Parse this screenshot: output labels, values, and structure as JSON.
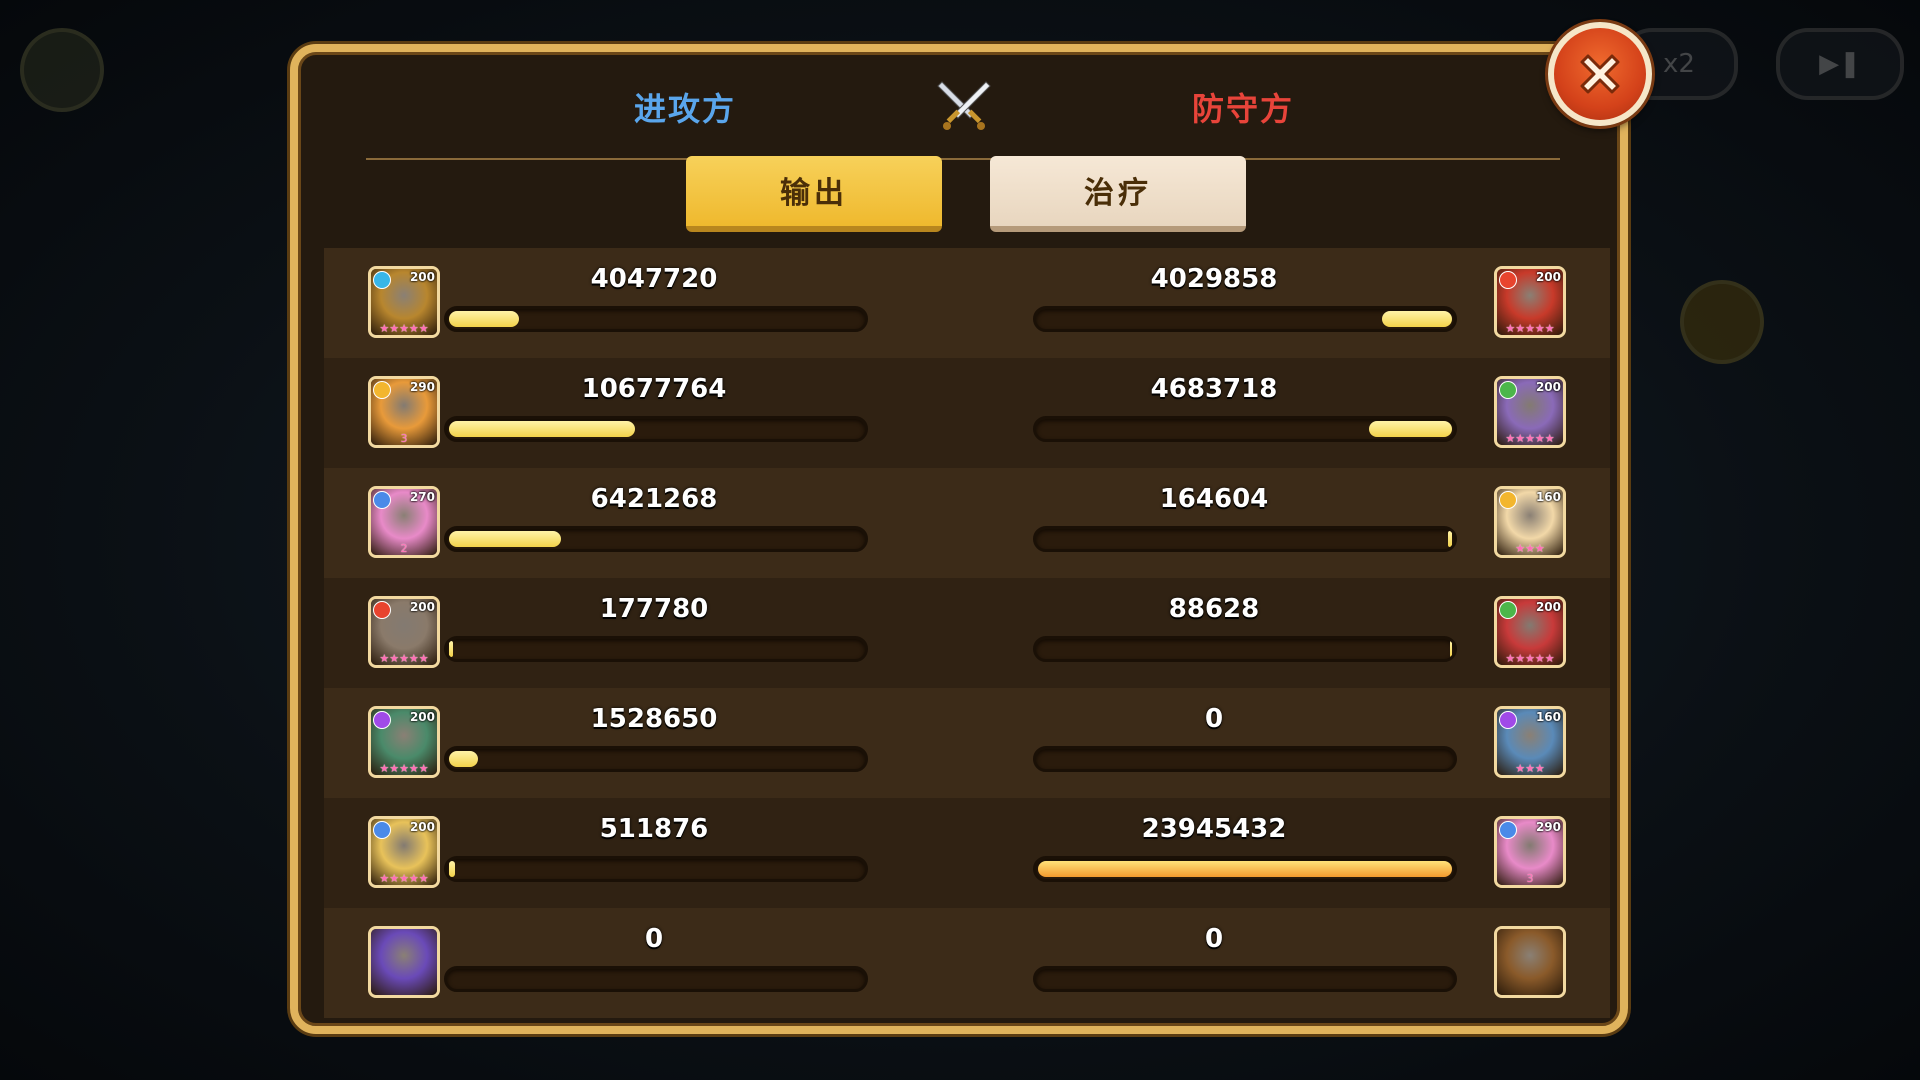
{
  "header": {
    "attacker_label": "进攻方",
    "defender_label": "防守方"
  },
  "tabs": {
    "output_label": "输出",
    "heal_label": "治疗",
    "selected": "输出"
  },
  "background": {
    "speed_label": "x2"
  },
  "colors": {
    "attacker": "#5aa6ec",
    "defender": "#e8443a",
    "bar_fill": "#f3d24a",
    "frame": "#e0b35c"
  },
  "rows": [
    {
      "attacker": {
        "value": "4047720",
        "fill": 0.17,
        "level": "200",
        "stars": "★★★★★",
        "element": "ice",
        "elem_color": "#38b6e8",
        "art": "#b8862e"
      },
      "defender": {
        "value": "4029858",
        "fill": 0.17,
        "level": "200",
        "stars": "★★★★★",
        "element": "fire",
        "elem_color": "#e8442e",
        "art": "#c83a2a"
      }
    },
    {
      "attacker": {
        "value": "10677764",
        "fill": 0.45,
        "level": "290",
        "stars": "3",
        "element": "light",
        "elem_color": "#f3b62e",
        "art": "#e89a3a"
      },
      "defender": {
        "value": "4683718",
        "fill": 0.2,
        "level": "200",
        "stars": "★★★★★",
        "element": "nature",
        "elem_color": "#4cb64a",
        "art": "#8a6ab8"
      }
    },
    {
      "attacker": {
        "value": "6421268",
        "fill": 0.27,
        "level": "270",
        "stars": "2",
        "element": "holy",
        "elem_color": "#4a8ae8",
        "art": "#e88ac8"
      },
      "defender": {
        "value": "164604",
        "fill": 0.01,
        "level": "160",
        "stars": "★★★",
        "element": "light",
        "elem_color": "#f3b62e",
        "art": "#f2d8a8"
      }
    },
    {
      "attacker": {
        "value": "177780",
        "fill": 0.01,
        "level": "200",
        "stars": "★★★★★",
        "element": "fire",
        "elem_color": "#e8442e",
        "art": "#8a7a6a"
      },
      "defender": {
        "value": "88628",
        "fill": 0.005,
        "level": "200",
        "stars": "★★★★★",
        "element": "nature",
        "elem_color": "#4cb64a",
        "art": "#c83a3a"
      }
    },
    {
      "attacker": {
        "value": "1528650",
        "fill": 0.07,
        "level": "200",
        "stars": "★★★★★",
        "element": "dark",
        "elem_color": "#a04ae8",
        "art": "#4a8a6a"
      },
      "defender": {
        "value": "0",
        "fill": 0,
        "level": "160",
        "stars": "★★★",
        "element": "dark",
        "elem_color": "#a04ae8",
        "art": "#5a8ab8"
      }
    },
    {
      "attacker": {
        "value": "511876",
        "fill": 0.015,
        "level": "200",
        "stars": "★★★★★",
        "element": "holy",
        "elem_color": "#4a8ae8",
        "art": "#e8c25a"
      },
      "defender": {
        "value": "23945432",
        "fill": 1.0,
        "level": "290",
        "stars": "3",
        "element": "holy",
        "elem_color": "#4a8ae8",
        "art": "#e88ac8"
      }
    },
    {
      "attacker": {
        "value": "0",
        "fill": 0,
        "level": "",
        "stars": "",
        "element": "",
        "elem_color": "",
        "art": "#6a4ab8"
      },
      "defender": {
        "value": "0",
        "fill": 0,
        "level": "",
        "stars": "",
        "element": "",
        "elem_color": "",
        "art": "#8a5a2a"
      }
    }
  ]
}
